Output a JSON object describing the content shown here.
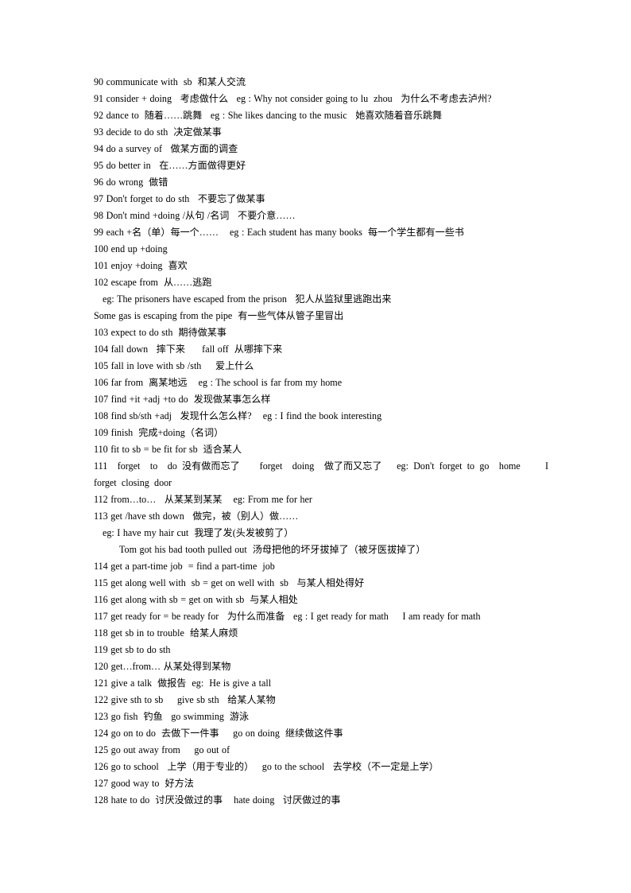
{
  "document": {
    "title": "English Phrases List 90-128",
    "background_color": "#ffffff",
    "text_color": "#000000",
    "lines": [
      {
        "id": "line-90",
        "indent": 0,
        "justify": false,
        "text": "90 communicate with  sb  和某人交流"
      },
      {
        "id": "line-91",
        "indent": 0,
        "justify": false,
        "text": "91 consider + doing   考虑做什么   eg : Why not consider going to lu  zhou   为什么不考虑去泸州?"
      },
      {
        "id": "line-92",
        "indent": 0,
        "justify": false,
        "text": "92 dance to  随着……跳舞   eg : She likes dancing to the music   她喜欢随着音乐跳舞"
      },
      {
        "id": "line-93",
        "indent": 0,
        "justify": false,
        "text": "93 decide to do sth  决定做某事"
      },
      {
        "id": "line-94",
        "indent": 0,
        "justify": false,
        "text": "94 do a survey of   做某方面的调查"
      },
      {
        "id": "line-95",
        "indent": 0,
        "justify": false,
        "text": "95 do better in   在……方面做得更好"
      },
      {
        "id": "line-96",
        "indent": 0,
        "justify": false,
        "text": "96 do wrong  做错"
      },
      {
        "id": "line-97",
        "indent": 0,
        "justify": false,
        "text": "97 Don't forget to do sth   不要忘了做某事"
      },
      {
        "id": "line-98",
        "indent": 0,
        "justify": false,
        "text": "98 Don't mind +doing /从句 /名词   不要介意……"
      },
      {
        "id": "line-99",
        "indent": 0,
        "justify": false,
        "text": "99 each +名（单）每一个……    eg : Each student has many books  每一个学生都有一些书"
      },
      {
        "id": "line-100",
        "indent": 0,
        "justify": false,
        "text": "100 end up +doing"
      },
      {
        "id": "line-101",
        "indent": 0,
        "justify": false,
        "text": "101 enjoy +doing  喜欢"
      },
      {
        "id": "line-102",
        "indent": 0,
        "justify": false,
        "text": "102 escape from  从……逃跑"
      },
      {
        "id": "line-102-eg",
        "indent": 1,
        "justify": false,
        "text": "eg: The prisoners have escaped from the prison   犯人从监狱里逃跑出来"
      },
      {
        "id": "line-102-eg2",
        "indent": 0,
        "justify": false,
        "text": "Some gas is escaping from the pipe  有一些气体从管子里冒出"
      },
      {
        "id": "line-103",
        "indent": 0,
        "justify": false,
        "text": "103 expect to do sth  期待做某事"
      },
      {
        "id": "line-104",
        "indent": 0,
        "justify": false,
        "text": "104 fall down   摔下来      fall off  从哪摔下来"
      },
      {
        "id": "line-105",
        "indent": 0,
        "justify": false,
        "text": "105 fall in love with sb /sth     爱上什么"
      },
      {
        "id": "line-106",
        "indent": 0,
        "justify": false,
        "text": "106 far from  离某地远    eg : The school is far from my home"
      },
      {
        "id": "line-107",
        "indent": 0,
        "justify": false,
        "text": "107 find +it +adj +to do  发现做某事怎么样"
      },
      {
        "id": "line-108",
        "indent": 0,
        "justify": false,
        "text": "108 find sb/sth +adj   发现什么怎么样?    eg : I find the book interesting"
      },
      {
        "id": "line-109",
        "indent": 0,
        "justify": false,
        "text": "109 finish  完成+doing（名词）"
      },
      {
        "id": "line-110",
        "indent": 0,
        "justify": false,
        "text": "110 fit to sb = be fit for sb  适合某人"
      },
      {
        "id": "line-111",
        "indent": 0,
        "justify": true,
        "text": "111  forget  to  do 没有做而忘了    forget  doing  做了而又忘了   eg: Don't forget to go  home     I  forget closing door"
      },
      {
        "id": "line-112",
        "indent": 0,
        "justify": false,
        "text": "112 from…to…   从某某到某某    eg: From me for her"
      },
      {
        "id": "line-113",
        "indent": 0,
        "justify": false,
        "text": "113 get /have sth down   做完，被（别人）做……"
      },
      {
        "id": "line-113-eg",
        "indent": 1,
        "justify": false,
        "text": "eg: I have my hair cut  我理了发(头发被剪了）"
      },
      {
        "id": "line-113-eg2",
        "indent": 2,
        "justify": false,
        "text": "Tom got his bad tooth pulled out  汤母把他的坏牙拔掉了（被牙医拔掉了）"
      },
      {
        "id": "line-114",
        "indent": 0,
        "justify": false,
        "text": "114 get a part-time job  = find a part-time  job"
      },
      {
        "id": "line-115",
        "indent": 0,
        "justify": false,
        "text": "115 get along well with  sb = get on well with  sb   与某人相处得好"
      },
      {
        "id": "line-116",
        "indent": 0,
        "justify": false,
        "text": "116 get along with sb = get on with sb  与某人相处"
      },
      {
        "id": "line-117",
        "indent": 0,
        "justify": false,
        "text": "117 get ready for = be ready for   为什么而准备   eg : I get ready for math     I am ready for math"
      },
      {
        "id": "line-118",
        "indent": 0,
        "justify": false,
        "text": "118 get sb in to trouble  给某人麻烦"
      },
      {
        "id": "line-119",
        "indent": 0,
        "justify": false,
        "text": "119 get sb to do sth"
      },
      {
        "id": "line-120",
        "indent": 0,
        "justify": false,
        "text": "120 get…from… 从某处得到某物"
      },
      {
        "id": "line-121",
        "indent": 0,
        "justify": false,
        "text": "121 give a talk  做报告  eg:  He is give a tall"
      },
      {
        "id": "line-122",
        "indent": 0,
        "justify": false,
        "text": "122 give sth to sb     give sb sth   给某人某物"
      },
      {
        "id": "line-123",
        "indent": 0,
        "justify": false,
        "text": "123 go fish  钓鱼   go swimming  游泳"
      },
      {
        "id": "line-124",
        "indent": 0,
        "justify": false,
        "text": "124 go on to do  去做下一件事     go on doing  继续做这件事"
      },
      {
        "id": "line-125",
        "indent": 0,
        "justify": false,
        "text": "125 go out away from     go out of"
      },
      {
        "id": "line-126",
        "indent": 0,
        "justify": false,
        "text": "126 go to school   上学（用于专业的）   go to the school   去学校（不一定是上学）"
      },
      {
        "id": "line-127",
        "indent": 0,
        "justify": false,
        "text": "127 good way to  好方法"
      },
      {
        "id": "line-128",
        "indent": 0,
        "justify": false,
        "text": "128 hate to do  讨厌没做过的事    hate doing   讨厌做过的事"
      }
    ]
  }
}
